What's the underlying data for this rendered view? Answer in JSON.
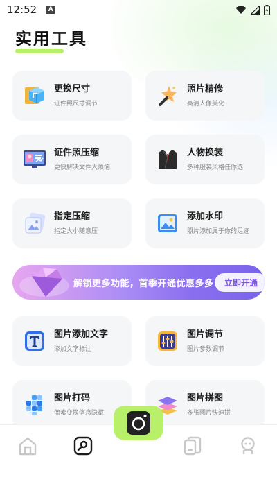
{
  "status_bar": {
    "time": "12:52",
    "badge": "A"
  },
  "page": {
    "title": "实用工具"
  },
  "tools": [
    {
      "title": "更换尺寸",
      "subtitle": "证件照尺寸调节",
      "icon": "resize-cube-icon"
    },
    {
      "title": "照片精修",
      "subtitle": "高清人像美化",
      "icon": "magic-wand-icon"
    },
    {
      "title": "证件照压缩",
      "subtitle": "更快解决文件大烦恼",
      "icon": "id-photo-monitor-icon"
    },
    {
      "title": "人物换装",
      "subtitle": "多种服装风格任你选",
      "icon": "suit-icon"
    },
    {
      "title": "指定压缩",
      "subtitle": "指定大小随意压",
      "icon": "image-stack-icon"
    },
    {
      "title": "添加水印",
      "subtitle": "照片添加属于你的足迹",
      "icon": "image-watermark-icon"
    },
    {
      "title": "图片添加文字",
      "subtitle": "添加文字标注",
      "icon": "text-t-icon"
    },
    {
      "title": "图片调节",
      "subtitle": "图片参数调节",
      "icon": "sliders-icon"
    },
    {
      "title": "图片打码",
      "subtitle": "像素变换信息隐藏",
      "icon": "pixel-mosaic-icon"
    },
    {
      "title": "图片拼图",
      "subtitle": "多张图片快速拼",
      "icon": "layers-stack-icon"
    }
  ],
  "banner": {
    "text": "解锁更多功能，首季开通优惠多多",
    "button": "立即开通"
  },
  "nav": {
    "items": [
      "home-icon",
      "tools-icon",
      "camera-icon",
      "gallery-icon",
      "profile-icon"
    ],
    "active": "tools-icon"
  },
  "colors": {
    "accent": "#b8f06a",
    "banner_button_text": "#7b52f0",
    "card_bg": "#f5f6f7"
  }
}
